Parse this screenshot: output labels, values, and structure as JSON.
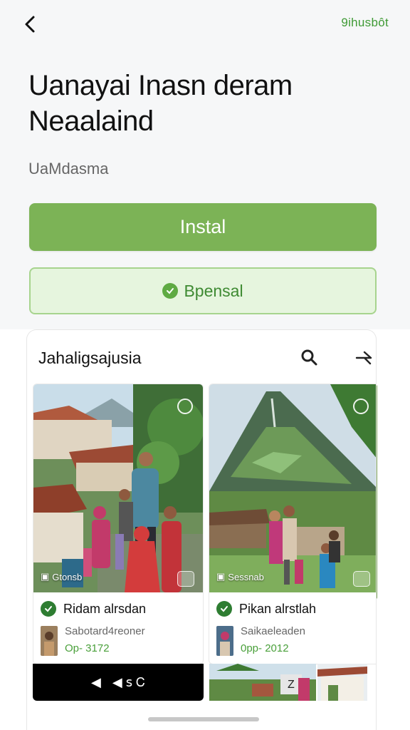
{
  "header": {
    "back_icon": "chevron-left-icon",
    "link_label": "9ihusbôt"
  },
  "app": {
    "title": "Uanayai Inasn deram Neaalaind",
    "subtitle": "UaMdasma"
  },
  "buttons": {
    "install_label": "Instal",
    "secondary_label": "Bpensal"
  },
  "panel": {
    "title": "Jahaligsajusia",
    "search_icon": "search-icon",
    "collapse_icon": "arrow-in-icon",
    "cards": [
      {
        "badge": "Gtonsb",
        "name": "Ridam alrsdan",
        "meta": "Sabotard4reoner",
        "price": "Op- 3172"
      },
      {
        "badge": "Sessnab",
        "name": "Pikan alrstlah",
        "meta": "Saikaeleaden",
        "price": "0pp- 2012"
      }
    ],
    "video_controls": "◀  ꜱ  Ꮯ",
    "strip_label": "Z"
  },
  "colors": {
    "accent": "#7cb356",
    "accent_text": "#3f9a35",
    "secondary_bg": "#e6f5de",
    "secondary_border": "#a7d48e"
  }
}
